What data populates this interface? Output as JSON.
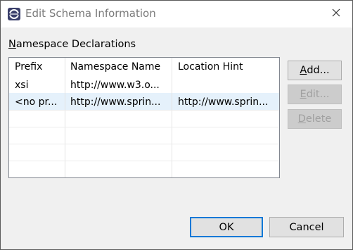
{
  "window": {
    "title": "Edit Schema Information",
    "icon": "eclipse-icon"
  },
  "section": {
    "label_u": "N",
    "label_rest": "amespace Declarations"
  },
  "table": {
    "columns": [
      "Prefix",
      "Namespace Name",
      "Location Hint"
    ],
    "rows": [
      {
        "prefix": "xsi",
        "namespace": "http://www.w3.o...",
        "location": "",
        "selected": false
      },
      {
        "prefix": "<no pr...",
        "namespace": "http://www.sprin...",
        "location": "http://www.sprin...",
        "selected": true
      }
    ]
  },
  "buttons": {
    "add_u": "A",
    "add_rest": "dd...",
    "edit_u": "E",
    "edit_rest": "dit...",
    "delete_u": "D",
    "delete_rest": "elete",
    "ok": "OK",
    "cancel": "Cancel"
  },
  "colors": {
    "selection": "#e5f1fb",
    "default_button_border": "#0078d7"
  }
}
